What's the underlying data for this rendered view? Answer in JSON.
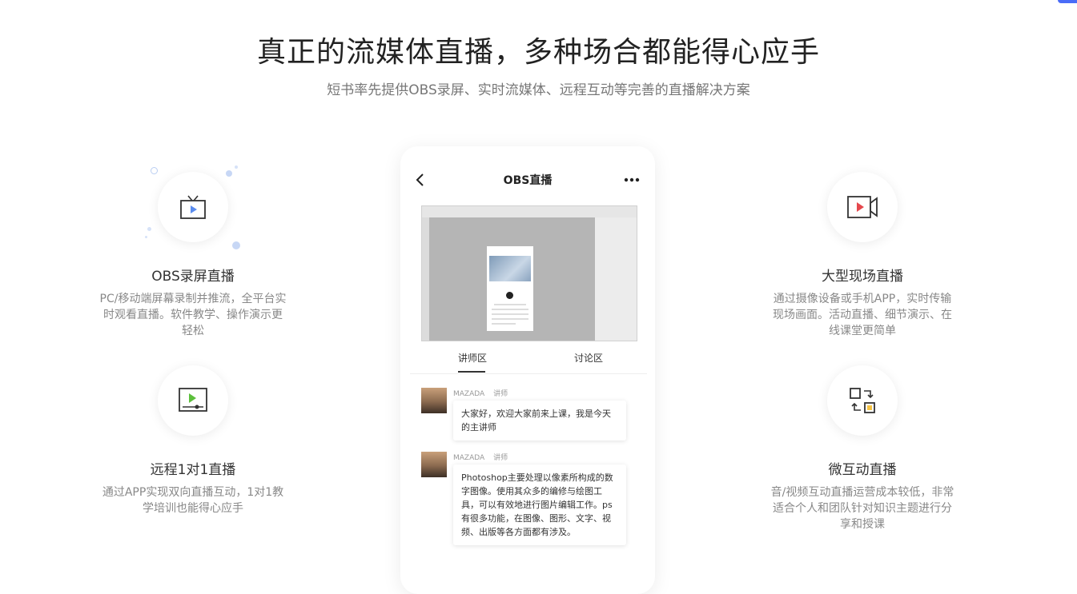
{
  "hero": {
    "title": "真正的流媒体直播，多种场合都能得心应手",
    "subtitle": "短书率先提供OBS录屏、实时流媒体、远程互动等完善的直播解决方案"
  },
  "features": [
    {
      "icon": "tv-icon",
      "title": "OBS录屏直播",
      "desc": "PC/移动端屏幕录制并推流，全平台实时观看直播。软件教学、操作演示更轻松"
    },
    {
      "icon": "video-camera-icon",
      "title": "大型现场直播",
      "desc": "通过摄像设备或手机APP，实时传输现场画面。活动直播、细节演示、在线课堂更简单"
    },
    {
      "icon": "screen-play-icon",
      "title": "远程1对1直播",
      "desc": "通过APP实现双向直播互动，1对1教学培训也能得心应手"
    },
    {
      "icon": "exchange-icon",
      "title": "微互动直播",
      "desc": "音/视频互动直播运营成本较低，非常适合个人和团队针对知识主题进行分享和授课"
    }
  ],
  "phone": {
    "title": "OBS直播",
    "tabs": [
      "讲师区",
      "讨论区"
    ],
    "messages": [
      {
        "name": "MAZADA",
        "role": "讲师",
        "text": "大家好，欢迎大家前来上课，我是今天的主讲师"
      },
      {
        "name": "MAZADA",
        "role": "讲师",
        "text": "Photoshop主要处理以像素所构成的数字图像。使用其众多的编修与绘图工具，可以有效地进行图片编辑工作。ps有很多功能，在图像、图形、文字、视频、出版等各方面都有涉及。"
      }
    ]
  },
  "colors": {
    "accent_blue": "#5b8def",
    "accent_red": "#e5484d",
    "accent_green": "#5cbf3c",
    "accent_yellow": "#f5c343"
  }
}
